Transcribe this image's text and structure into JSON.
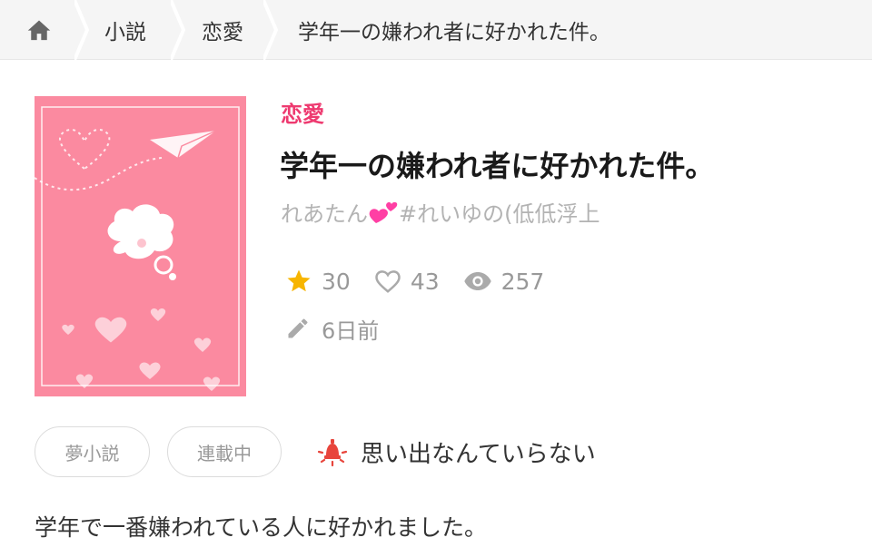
{
  "breadcrumb": {
    "home_icon": "home-icon",
    "items": [
      "小説",
      "恋愛",
      "学年一の嫌われ者に好かれた件。"
    ]
  },
  "story": {
    "genre": "恋愛",
    "title": "学年一の嫌われ者に好かれた件。",
    "author_prefix": "れあたん",
    "author_suffix": "#れいゆの(低低浮上",
    "author_emoji": "two-hearts-emoji",
    "stars": "30",
    "likes": "43",
    "views": "257",
    "updated": "6日前"
  },
  "tags": [
    "夢小説",
    "連載中"
  ],
  "notice": {
    "icon": "alert-light-icon",
    "text": "思い出なんていらない"
  },
  "description": "学年で一番嫌われている人に好かれました。",
  "colors": {
    "accent": "#ee3a70",
    "cover": "#fb8aa0",
    "star": "#f7b500",
    "muted": "#999999",
    "notice_icon": "#e8453c"
  }
}
